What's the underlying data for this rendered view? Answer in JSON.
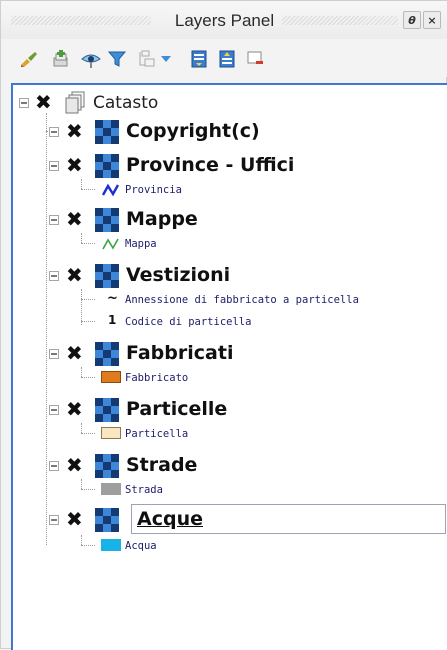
{
  "titlebar": {
    "title": "Layers Panel",
    "float_label": "θ",
    "close_label": "×"
  },
  "toolbar": {
    "icons": [
      "paint-brush-icon",
      "add-group-icon",
      "visibility-eye-icon",
      "filter-icon",
      "filter-legend-icon",
      "expand-all-icon",
      "collapse-all-icon",
      "remove-layer-icon"
    ]
  },
  "tree": {
    "group": {
      "name": "Catasto",
      "check": "✖"
    },
    "layers": [
      {
        "name": "Copyright(c)",
        "check": "✖",
        "legend": []
      },
      {
        "name": "Province - Uffici",
        "check": "✖",
        "legend": [
          {
            "symbol": "line-blue",
            "label": "Provincia"
          }
        ]
      },
      {
        "name": "Mappe",
        "check": "✖",
        "legend": [
          {
            "symbol": "line-green",
            "label": "Mappa"
          }
        ]
      },
      {
        "name": "Vestizioni",
        "check": "✖",
        "legend": [
          {
            "symbol": "tilde",
            "label": "Annessione di fabbricato a particella",
            "glyph": "~"
          },
          {
            "symbol": "one",
            "label": "Codice di particella",
            "glyph": "1"
          }
        ]
      },
      {
        "name": "Fabbricati",
        "check": "✖",
        "legend": [
          {
            "symbol": "fill",
            "label": "Fabbricato",
            "color": "#e07a1f",
            "stroke": "#8a4a10"
          }
        ]
      },
      {
        "name": "Particelle",
        "check": "✖",
        "legend": [
          {
            "symbol": "fill",
            "label": "Particella",
            "color": "#f7e6bf",
            "stroke": "#8b7a55"
          }
        ]
      },
      {
        "name": "Strade",
        "check": "✖",
        "legend": [
          {
            "symbol": "fill",
            "label": "Strada",
            "color": "#9e9e9e",
            "stroke": "#9e9e9e"
          }
        ]
      },
      {
        "name": "Acque",
        "check": "✖",
        "editing": true,
        "legend": [
          {
            "symbol": "fill",
            "label": "Acqua",
            "color": "#18b3e6",
            "stroke": "#18b3e6"
          }
        ]
      }
    ]
  },
  "colors": {
    "tree_border": "#3e78d0",
    "raster_dark": "#143a73",
    "raster_light": "#3d86d8"
  }
}
